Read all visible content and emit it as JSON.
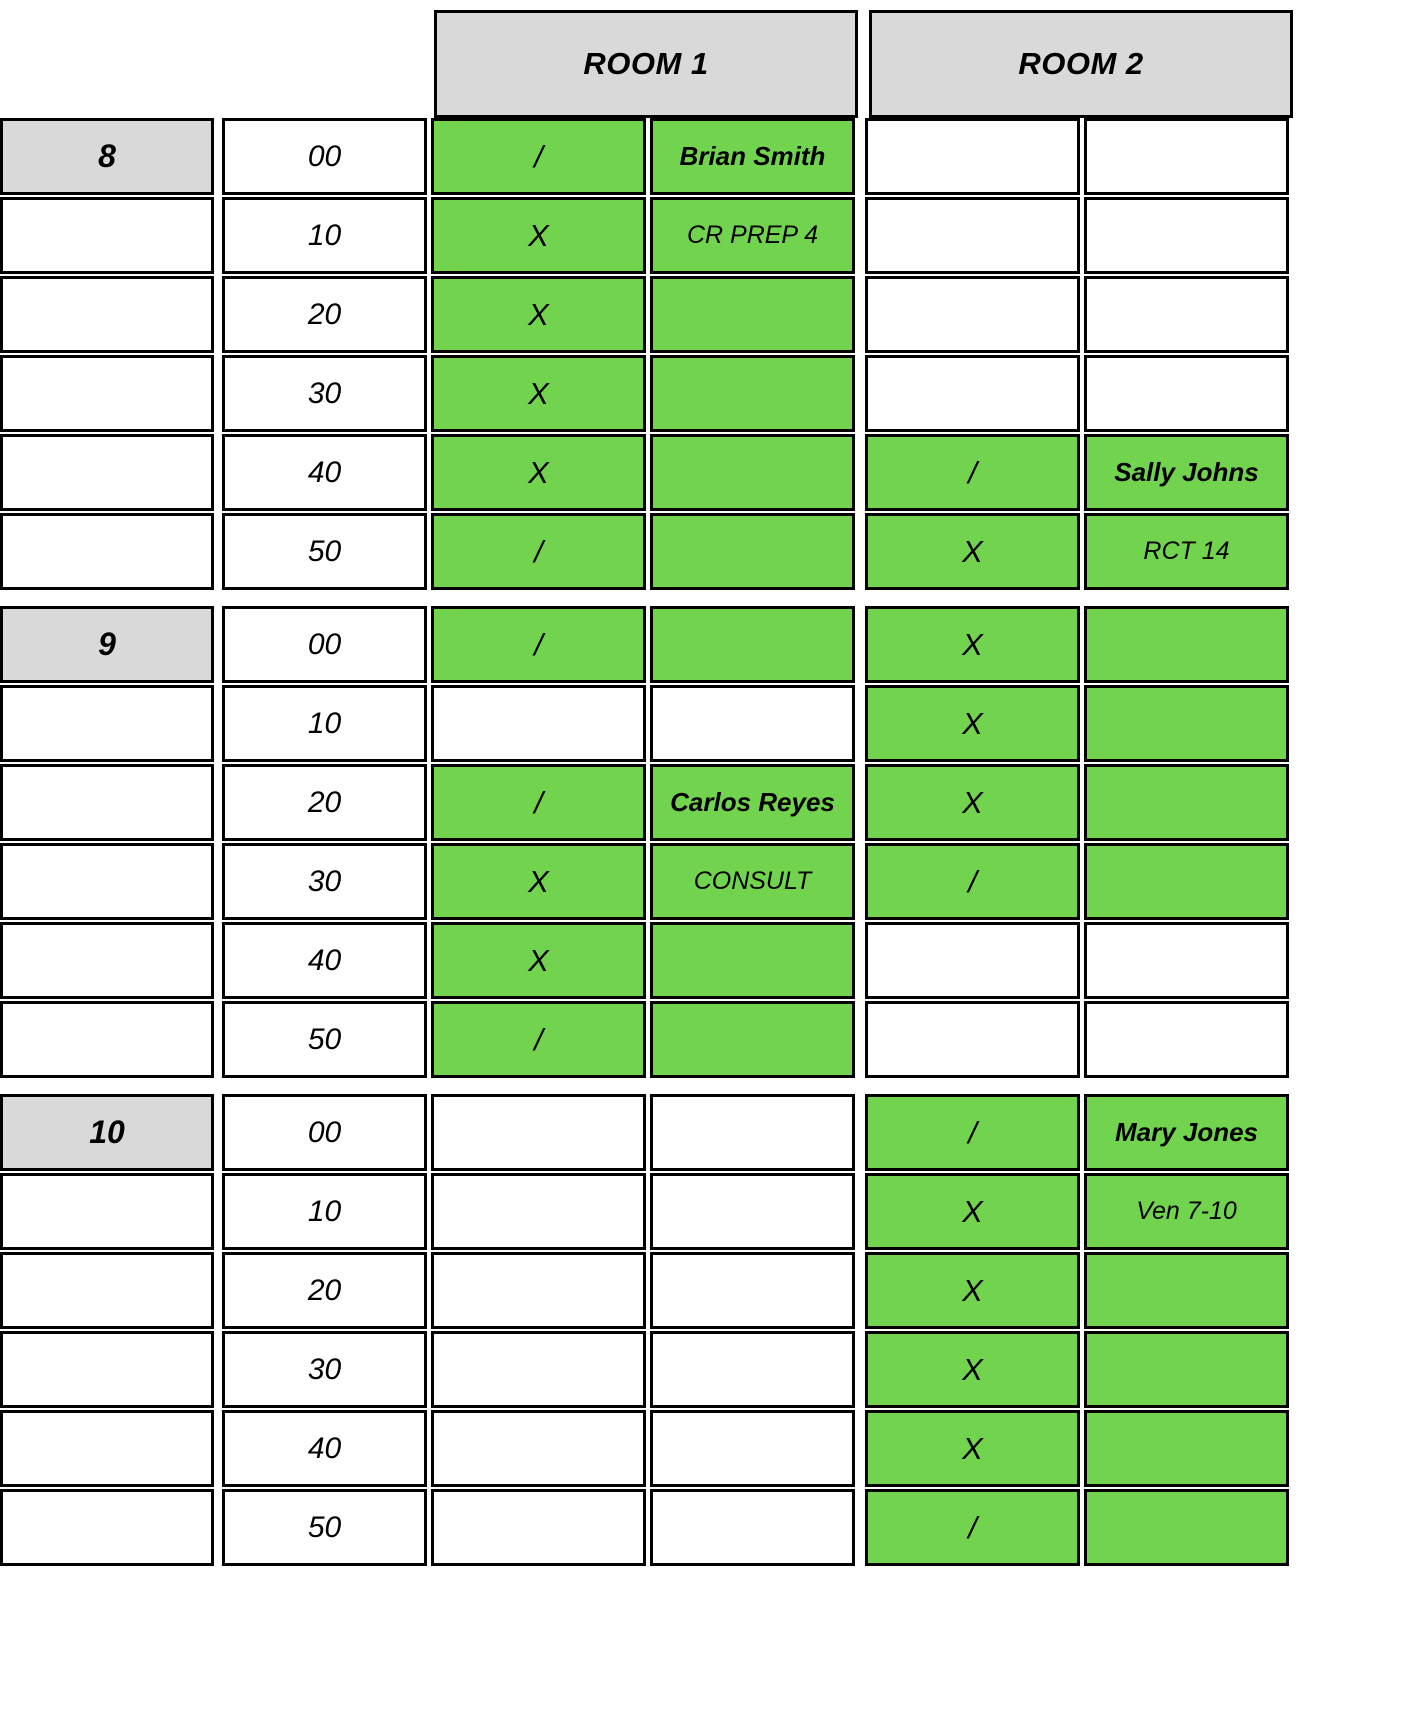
{
  "colors": {
    "booked_green": "#72d34e",
    "header_gray": "#d9d9d9",
    "grid_black": "#000000",
    "empty_white": "#ffffff"
  },
  "columns": {
    "hour_header": "",
    "minute_header": "",
    "rooms": [
      {
        "id": "room1",
        "label": "ROOM 1"
      },
      {
        "id": "room2",
        "label": "ROOM 2"
      }
    ]
  },
  "legend": {
    "start_marker": "/",
    "continue_marker": "X",
    "empty_marker": ""
  },
  "appointments": [
    {
      "room": "ROOM 1",
      "patient": "Brian Smith",
      "procedure": "CR PREP 4",
      "start": "8:00",
      "end": "8:50"
    },
    {
      "room": "ROOM 2",
      "patient": "Sally Johns",
      "procedure": "RCT 14",
      "start": "8:40",
      "end": "9:00"
    },
    {
      "room": "ROOM 1",
      "patient": "Carlos Reyes",
      "procedure": "CONSULT",
      "start": "9:20",
      "end": "9:50"
    },
    {
      "room": "ROOM 2",
      "patient": "Mary Jones",
      "procedure": "Ven 7-10",
      "start": "10:00",
      "end": "10:50"
    }
  ],
  "blocks": [
    {
      "hour": "8",
      "rows": [
        {
          "minute": "00",
          "room1": {
            "mark": "/",
            "detail": "Brian Smith",
            "detail_style": "name",
            "booked": true
          },
          "room2": {
            "mark": "",
            "detail": "",
            "detail_style": "",
            "booked": false
          }
        },
        {
          "minute": "10",
          "room1": {
            "mark": "X",
            "detail": "CR PREP 4",
            "detail_style": "proc",
            "booked": true
          },
          "room2": {
            "mark": "",
            "detail": "",
            "detail_style": "",
            "booked": false
          }
        },
        {
          "minute": "20",
          "room1": {
            "mark": "X",
            "detail": "",
            "detail_style": "",
            "booked": true
          },
          "room2": {
            "mark": "",
            "detail": "",
            "detail_style": "",
            "booked": false
          }
        },
        {
          "minute": "30",
          "room1": {
            "mark": "X",
            "detail": "",
            "detail_style": "",
            "booked": true
          },
          "room2": {
            "mark": "",
            "detail": "",
            "detail_style": "",
            "booked": false
          }
        },
        {
          "minute": "40",
          "room1": {
            "mark": "X",
            "detail": "",
            "detail_style": "",
            "booked": true
          },
          "room2": {
            "mark": "/",
            "detail": "Sally Johns",
            "detail_style": "name",
            "booked": true
          }
        },
        {
          "minute": "50",
          "room1": {
            "mark": "/",
            "detail": "",
            "detail_style": "",
            "booked": true
          },
          "room2": {
            "mark": "X",
            "detail": "RCT 14",
            "detail_style": "proc",
            "booked": true
          }
        }
      ]
    },
    {
      "hour": "9",
      "rows": [
        {
          "minute": "00",
          "room1": {
            "mark": "/",
            "detail": "",
            "detail_style": "",
            "booked": true
          },
          "room2": {
            "mark": "X",
            "detail": "",
            "detail_style": "",
            "booked": true
          }
        },
        {
          "minute": "10",
          "room1": {
            "mark": "",
            "detail": "",
            "detail_style": "",
            "booked": false
          },
          "room2": {
            "mark": "X",
            "detail": "",
            "detail_style": "",
            "booked": true
          }
        },
        {
          "minute": "20",
          "room1": {
            "mark": "/",
            "detail": "Carlos Reyes",
            "detail_style": "name",
            "booked": true
          },
          "room2": {
            "mark": "X",
            "detail": "",
            "detail_style": "",
            "booked": true
          }
        },
        {
          "minute": "30",
          "room1": {
            "mark": "X",
            "detail": "CONSULT",
            "detail_style": "proc",
            "booked": true
          },
          "room2": {
            "mark": "/",
            "detail": "",
            "detail_style": "",
            "booked": true
          }
        },
        {
          "minute": "40",
          "room1": {
            "mark": "X",
            "detail": "",
            "detail_style": "",
            "booked": true
          },
          "room2": {
            "mark": "",
            "detail": "",
            "detail_style": "",
            "booked": false
          }
        },
        {
          "minute": "50",
          "room1": {
            "mark": "/",
            "detail": "",
            "detail_style": "",
            "booked": true
          },
          "room2": {
            "mark": "",
            "detail": "",
            "detail_style": "",
            "booked": false
          }
        }
      ]
    },
    {
      "hour": "10",
      "rows": [
        {
          "minute": "00",
          "room1": {
            "mark": "",
            "detail": "",
            "detail_style": "",
            "booked": false
          },
          "room2": {
            "mark": "/",
            "detail": "Mary Jones",
            "detail_style": "name",
            "booked": true
          }
        },
        {
          "minute": "10",
          "room1": {
            "mark": "",
            "detail": "",
            "detail_style": "",
            "booked": false
          },
          "room2": {
            "mark": "X",
            "detail": "Ven 7-10",
            "detail_style": "proc",
            "booked": true
          }
        },
        {
          "minute": "20",
          "room1": {
            "mark": "",
            "detail": "",
            "detail_style": "",
            "booked": false
          },
          "room2": {
            "mark": "X",
            "detail": "",
            "detail_style": "",
            "booked": true
          }
        },
        {
          "minute": "30",
          "room1": {
            "mark": "",
            "detail": "",
            "detail_style": "",
            "booked": false
          },
          "room2": {
            "mark": "X",
            "detail": "",
            "detail_style": "",
            "booked": true
          }
        },
        {
          "minute": "40",
          "room1": {
            "mark": "",
            "detail": "",
            "detail_style": "",
            "booked": false
          },
          "room2": {
            "mark": "X",
            "detail": "",
            "detail_style": "",
            "booked": true
          }
        },
        {
          "minute": "50",
          "room1": {
            "mark": "",
            "detail": "",
            "detail_style": "",
            "booked": false
          },
          "room2": {
            "mark": "/",
            "detail": "",
            "detail_style": "",
            "booked": true
          }
        }
      ]
    }
  ]
}
